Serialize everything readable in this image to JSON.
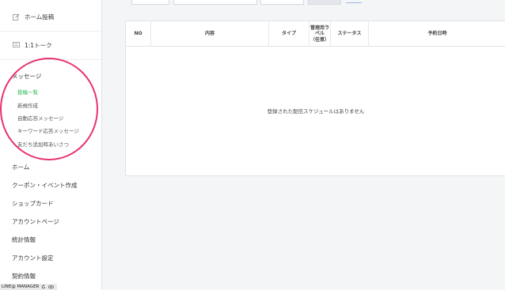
{
  "sidebar": {
    "home_post": "ホーム投稿",
    "one_to_one_talk": "1:1トーク",
    "message_section": {
      "title": "メッセージ",
      "items": [
        "投稿一覧",
        "新規作成",
        "自動応答メッセージ",
        "キーワード応答メッセージ",
        "友だち追加時あいさつ"
      ]
    },
    "main_items": [
      "ホーム",
      "クーポン・イベント作成",
      "ショップカード",
      "アカウントページ",
      "統計情報",
      "アカウント設定",
      "契約情報"
    ],
    "footer": "LINE@ MANAGER"
  },
  "table": {
    "headers": {
      "no": "NO",
      "content": "内容",
      "type": "タイプ",
      "label": "管理用ラベル\n（任意）",
      "status": "ステータス",
      "scheduled": "予約日時"
    },
    "empty_message": "登録された配信スケジュールはありません"
  },
  "colors": {
    "active_item": "#1db446",
    "annotation_circle": "#e8336f"
  },
  "icons": [
    "edit-icon",
    "chat-icon",
    "refresh-icon",
    "eye-icon"
  ]
}
